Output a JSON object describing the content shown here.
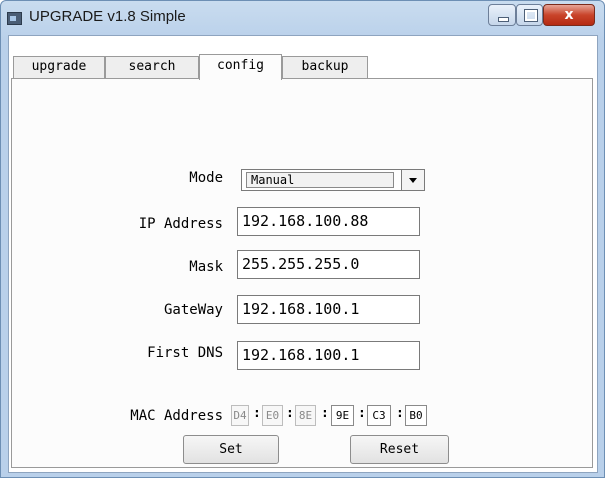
{
  "window": {
    "title": "UPGRADE v1.8 Simple",
    "close_glyph": "x"
  },
  "tabs": [
    {
      "label": "upgrade",
      "active": false
    },
    {
      "label": "search",
      "active": false
    },
    {
      "label": "config",
      "active": true
    },
    {
      "label": "backup",
      "active": false
    }
  ],
  "config": {
    "mode": {
      "label": "Mode",
      "value": "Manual"
    },
    "ip": {
      "label": "IP Address",
      "value": "192.168.100.88"
    },
    "mask": {
      "label": "Mask",
      "value": "255.255.255.0"
    },
    "gateway": {
      "label": "GateWay",
      "value": "192.168.100.1"
    },
    "dns": {
      "label": "First DNS",
      "value": "192.168.100.1"
    },
    "mac": {
      "label": "MAC Address",
      "octets": [
        "D4",
        "E0",
        "8E",
        "9E",
        "C3",
        "B0"
      ],
      "separator": ":"
    },
    "set_label": "Set",
    "reset_label": "Reset"
  },
  "colors": {
    "titlebar": "#b9d0ea",
    "close_button": "#c9442a",
    "panel": "#fcfcfc"
  }
}
